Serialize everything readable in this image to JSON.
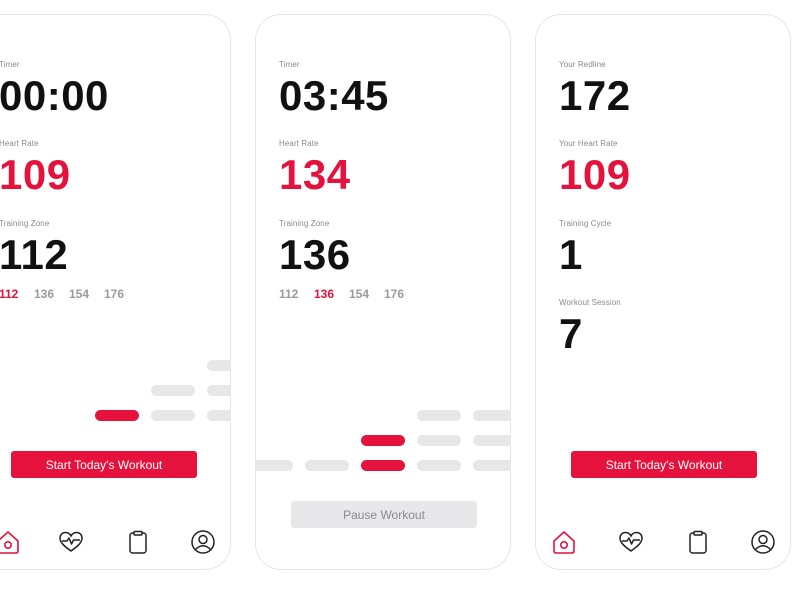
{
  "screen1": {
    "timer": {
      "label": "Timer",
      "value": "00:00"
    },
    "heart_rate": {
      "label": "Heart Rate",
      "value": "109"
    },
    "training_zone": {
      "label": "Training Zone",
      "value": "112"
    },
    "zones": [
      {
        "value": "112",
        "active": true
      },
      {
        "value": "136",
        "active": false
      },
      {
        "value": "154",
        "active": false
      },
      {
        "value": "176",
        "active": false
      }
    ],
    "button_label": "Start Today's Workout"
  },
  "screen2": {
    "timer": {
      "label": "Timer",
      "value": "03:45"
    },
    "heart_rate": {
      "label": "Heart Rate",
      "value": "134"
    },
    "training_zone": {
      "label": "Training Zone",
      "value": "136"
    },
    "zones": [
      {
        "value": "112",
        "active": false
      },
      {
        "value": "136",
        "active": true
      },
      {
        "value": "154",
        "active": false
      },
      {
        "value": "176",
        "active": false
      }
    ],
    "button_label": "Pause Workout"
  },
  "screen3": {
    "redline": {
      "label": "Your Redline",
      "value": "172"
    },
    "heart_rate": {
      "label": "Your Heart Rate",
      "value": "109"
    },
    "training_cycle": {
      "label": "Training Cycle",
      "value": "1"
    },
    "workout_session": {
      "label": "Workout Session",
      "value": "7"
    },
    "button_label": "Start Today's Workout"
  },
  "nav": {
    "items": [
      {
        "icon": "home-icon"
      },
      {
        "icon": "heart-pulse-icon"
      },
      {
        "icon": "clipboard-icon"
      },
      {
        "icon": "profile-icon"
      }
    ]
  },
  "colors": {
    "accent": "#e5123d",
    "muted_text": "#8a8a8e",
    "bar_inactive": "#e7e7ea",
    "button_disabled": "#e8e8eb"
  }
}
